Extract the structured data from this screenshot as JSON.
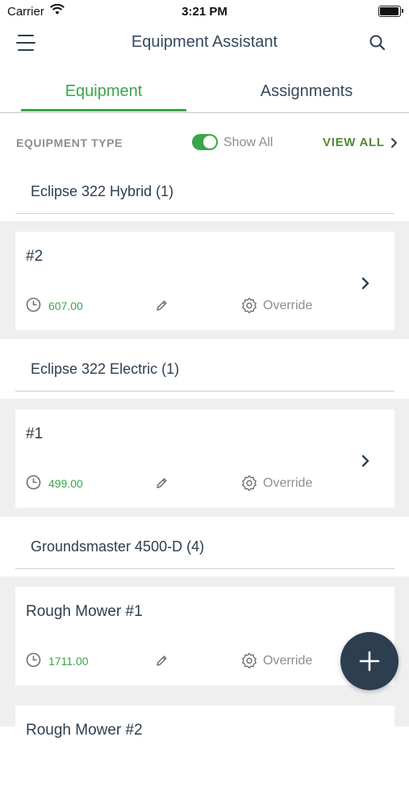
{
  "status_bar": {
    "carrier": "Carrier",
    "time": "3:21 PM"
  },
  "navbar": {
    "title": "Equipment Assistant",
    "menu_icon": "hamburger-menu-icon",
    "search_icon": "search-icon"
  },
  "tabs": [
    {
      "label": "Equipment",
      "active": true
    },
    {
      "label": "Assignments",
      "active": false
    }
  ],
  "filter": {
    "label": "EQUIPMENT TYPE",
    "toggle_label": "Show All",
    "toggle_on": true,
    "view_all": "VIEW ALL"
  },
  "groups": [
    {
      "title": "Eclipse 322 Hybrid  (1)",
      "items": [
        {
          "name": "#2",
          "hours": "607.00",
          "override": "Override"
        }
      ]
    },
    {
      "title": "Eclipse 322 Electric  (1)",
      "items": [
        {
          "name": "#1",
          "hours": "499.00",
          "override": "Override"
        }
      ]
    },
    {
      "title": "Groundsmaster 4500-D  (4)",
      "items": [
        {
          "name": "Rough Mower #1",
          "hours": "1711.00",
          "override": "Override"
        },
        {
          "name": "Rough Mower #2",
          "hours": "",
          "override": ""
        }
      ]
    }
  ],
  "fab": {
    "icon": "plus-icon"
  },
  "colors": {
    "accent": "#3aa64a",
    "fab": "#2c3e50",
    "link": "#4f8a33"
  }
}
